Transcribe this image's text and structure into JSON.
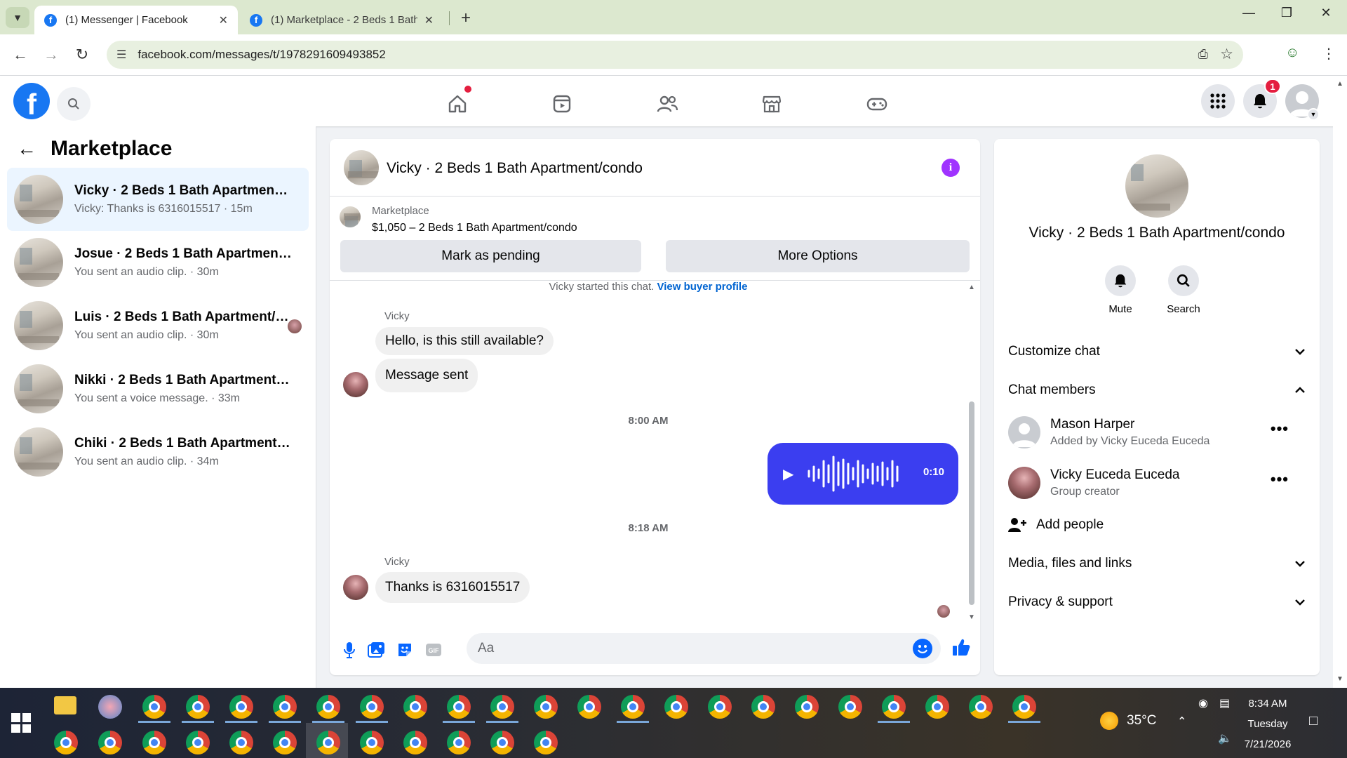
{
  "browser": {
    "tabs": [
      {
        "title": "(1) Messenger | Facebook",
        "active": true
      },
      {
        "title": "(1) Marketplace - 2 Beds 1 Bath",
        "active": false
      }
    ],
    "url": "facebook.com/messages/t/1978291609493852"
  },
  "fb_header": {
    "logo": "f",
    "notification_count": "1"
  },
  "left_panel": {
    "title": "Marketplace",
    "conversations": [
      {
        "name": "Vicky · 2 Beds 1 Bath Apartment/c...",
        "preview": "Vicky: Thanks is 6316015517 · 15m",
        "active": true
      },
      {
        "name": "Josue · 2 Beds 1 Bath Apartment/c...",
        "preview": "You sent an audio clip. · 30m",
        "active": false
      },
      {
        "name": "Luis · 2 Beds 1 Bath Apartment/c...",
        "preview": "You sent an audio clip. · 30m",
        "active": false
      },
      {
        "name": "Nikki · 2 Beds 1 Bath Apartment/c...",
        "preview": "You sent a voice message. · 33m",
        "active": false
      },
      {
        "name": "Chiki · 2 Beds 1 Bath Apartment/c...",
        "preview": "You sent an audio clip. · 34m",
        "active": false
      }
    ]
  },
  "chat": {
    "title": "Vicky · 2 Beds 1 Bath Apartment/condo",
    "listing": {
      "label": "Marketplace",
      "price_title": "$1,050 – 2 Beds 1 Bath Apartment/condo",
      "mark_pending": "Mark as pending",
      "more_options": "More Options"
    },
    "started_text": "Vicky started this chat.",
    "buyer_profile_link": "View buyer profile",
    "messages": {
      "sender1": "Vicky",
      "msg1": "Hello, is this still available?",
      "msg2": "Message sent",
      "time1": "8:00 AM",
      "audio_duration": "0:10",
      "time2": "8:18 AM",
      "sender2": "Vicky",
      "msg3": "Thanks is 6316015517"
    },
    "composer_placeholder": "Aa"
  },
  "info_panel": {
    "title": "Vicky · 2 Beds 1 Bath Apartment/condo",
    "mute_label": "Mute",
    "search_label": "Search",
    "customize_chat": "Customize chat",
    "chat_members": "Chat members",
    "members": [
      {
        "name": "Mason Harper",
        "sub": "Added by Vicky Euceda Euceda"
      },
      {
        "name": "Vicky Euceda Euceda",
        "sub": "Group creator"
      }
    ],
    "add_people": "Add people",
    "media_files_links": "Media, files and links",
    "privacy_support": "Privacy & support"
  },
  "taskbar": {
    "temperature": "35°C",
    "time": "8:34 AM",
    "day": "Tuesday",
    "date": "7/21/2026"
  }
}
